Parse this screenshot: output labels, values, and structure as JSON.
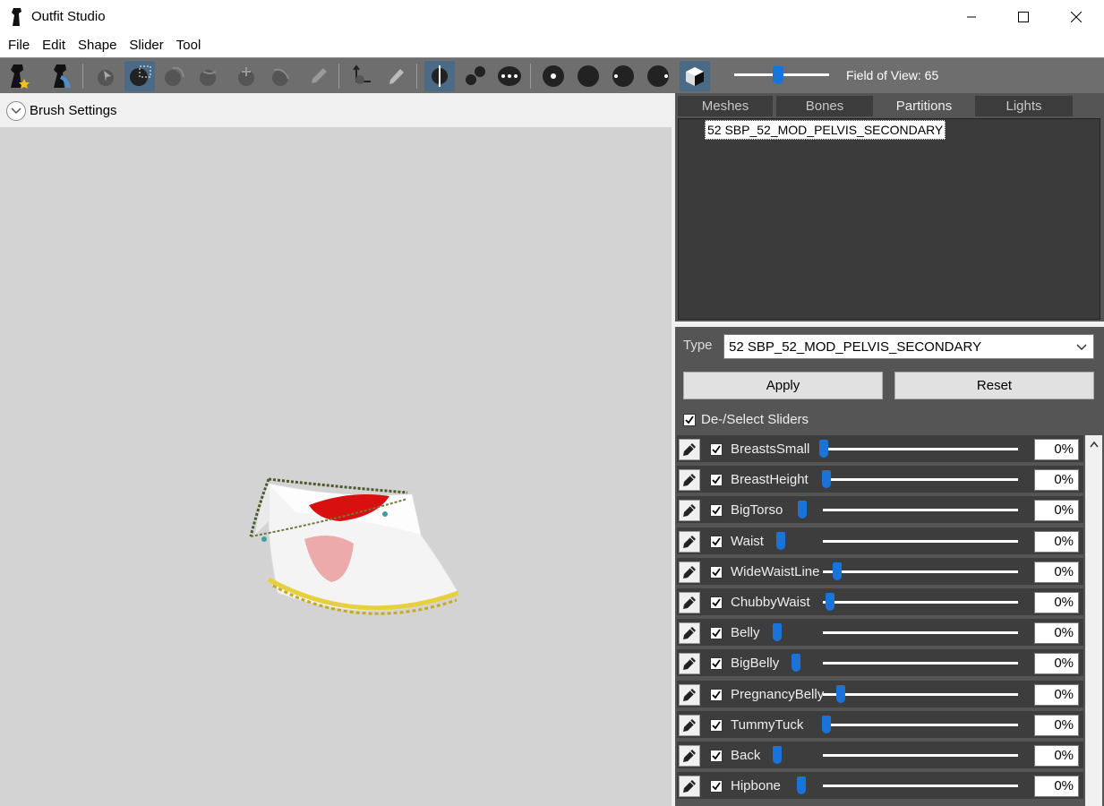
{
  "window": {
    "title": "Outfit Studio",
    "app_icon": "outfit-studio-icon",
    "controls": [
      "minimize-icon",
      "maximize-icon",
      "close-icon"
    ]
  },
  "menu": [
    "File",
    "Edit",
    "Shape",
    "Slider",
    "Tool"
  ],
  "toolbar": {
    "fov_label": "Field of View: 65",
    "fov_value": 65,
    "icons": [
      "new-project-icon",
      "load-outfit-icon",
      "select-icon",
      "mask-brush-icon",
      "inflate-brush-icon",
      "deflate-brush-icon",
      "move-brush-icon",
      "smooth-brush-icon",
      "weight-paint-icon",
      "transform-icon",
      "pick-icon",
      "mirror-x-icon",
      "connected-only-icon",
      "global-brush-icon",
      "small-dot-icon",
      "medium-dot-icon",
      "large-dot-icon",
      "xlarge-dot-icon",
      "cube-view-icon"
    ],
    "active_icons": [
      "mask-brush-icon",
      "mirror-x-icon",
      "cube-view-icon"
    ]
  },
  "brush_settings": {
    "label": "Brush Settings"
  },
  "tabs": [
    {
      "label": "Meshes",
      "active": false
    },
    {
      "label": "Bones",
      "active": false
    },
    {
      "label": "Partitions",
      "active": true
    },
    {
      "label": "Lights",
      "active": false
    }
  ],
  "partition_list": [
    "52 SBP_52_MOD_PELVIS_SECONDARY"
  ],
  "type_field": {
    "label": "Type",
    "value": "52 SBP_52_MOD_PELVIS_SECONDARY"
  },
  "buttons": {
    "apply": "Apply",
    "reset": "Reset"
  },
  "deselect": {
    "label": "De-/Select Sliders",
    "checked": true
  },
  "sliders": [
    {
      "name": "BreastsSmall",
      "value": "0%",
      "position": 0
    },
    {
      "name": "BreastHeight",
      "value": "0%",
      "position": 0
    },
    {
      "name": "BigTorso",
      "value": "0%",
      "position": 0
    },
    {
      "name": "Waist",
      "value": "0%",
      "position": 0
    },
    {
      "name": "WideWaistLine",
      "value": "0%",
      "position": 0
    },
    {
      "name": "ChubbyWaist",
      "value": "0%",
      "position": 0
    },
    {
      "name": "Belly",
      "value": "0%",
      "position": 0
    },
    {
      "name": "BigBelly",
      "value": "0%",
      "position": 0
    },
    {
      "name": "PregnancyBelly",
      "value": "0%",
      "position": 0
    },
    {
      "name": "TummyTuck",
      "value": "0%",
      "position": 0
    },
    {
      "name": "Back",
      "value": "0%",
      "position": 0
    },
    {
      "name": "Hipbone",
      "value": "0%",
      "position": 0
    }
  ],
  "colors": {
    "toolbar": "#6e6e6e",
    "panel": "#555555",
    "accent": "#1a73d9",
    "viewport": "#d3d3d3"
  }
}
